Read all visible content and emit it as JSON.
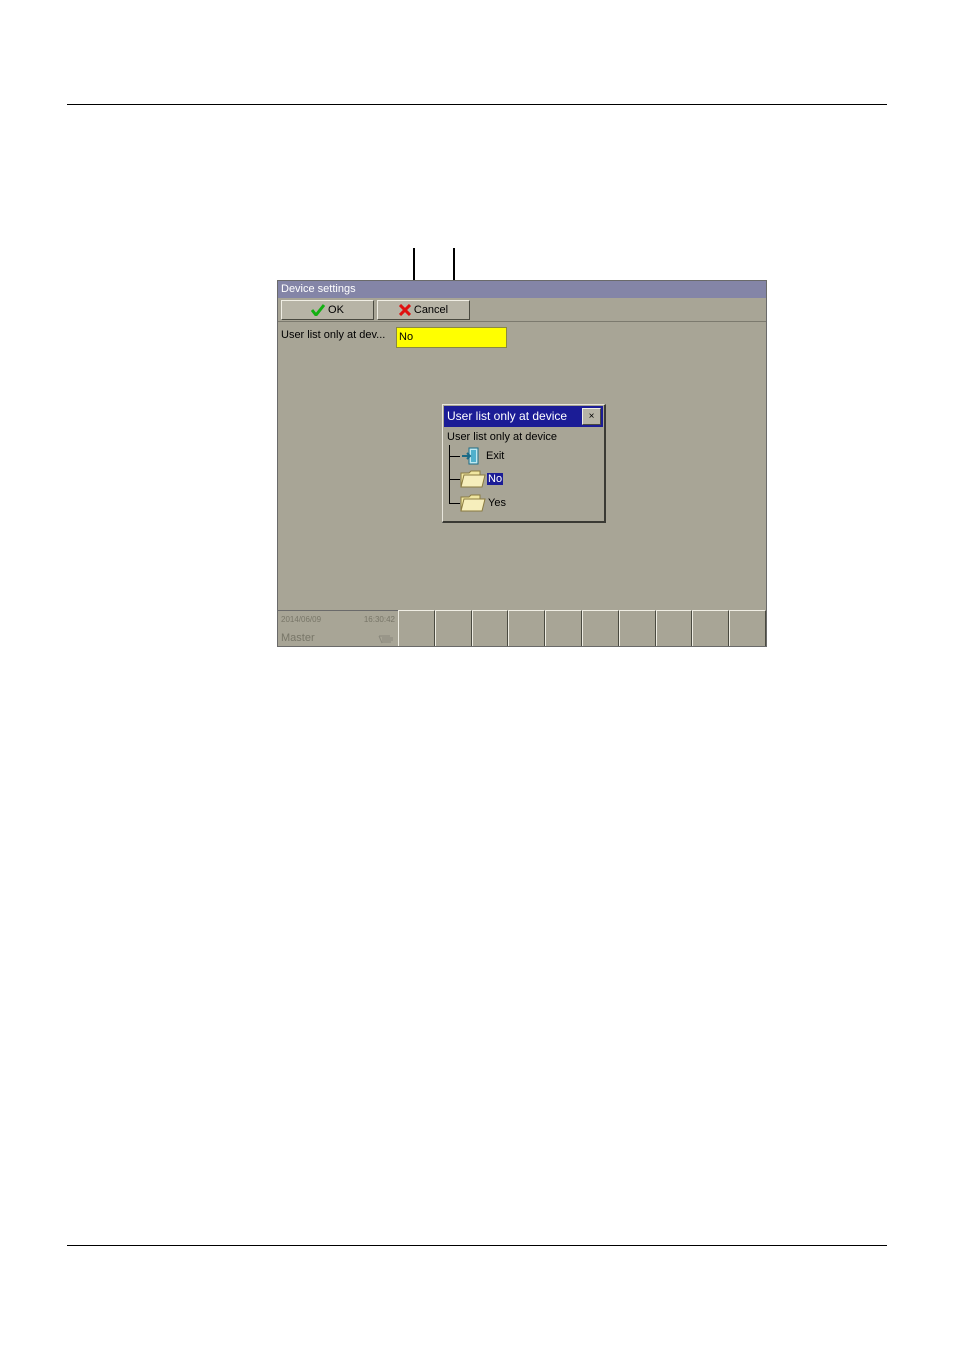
{
  "window": {
    "title": "Device settings"
  },
  "toolbar": {
    "ok_label": "OK",
    "cancel_label": "Cancel"
  },
  "setting": {
    "label": "User list only at dev...",
    "value": "No"
  },
  "dialog": {
    "title": "User list only at device",
    "close_glyph": "×",
    "root_label": "User list only at device",
    "items": [
      {
        "label": "Exit",
        "icon": "exit-icon"
      },
      {
        "label": "No",
        "icon": "folder-icon",
        "selected": true
      },
      {
        "label": "Yes",
        "icon": "folder-icon"
      }
    ]
  },
  "status": {
    "date": "2014/06/09",
    "time": "16:30:42",
    "user": "Master",
    "icon": "hand-icon"
  },
  "colors": {
    "title_bar": "#8485a7",
    "dialog_title": "#1b1c96",
    "field_highlight": "#ffff00",
    "panel": "#a8a596"
  }
}
